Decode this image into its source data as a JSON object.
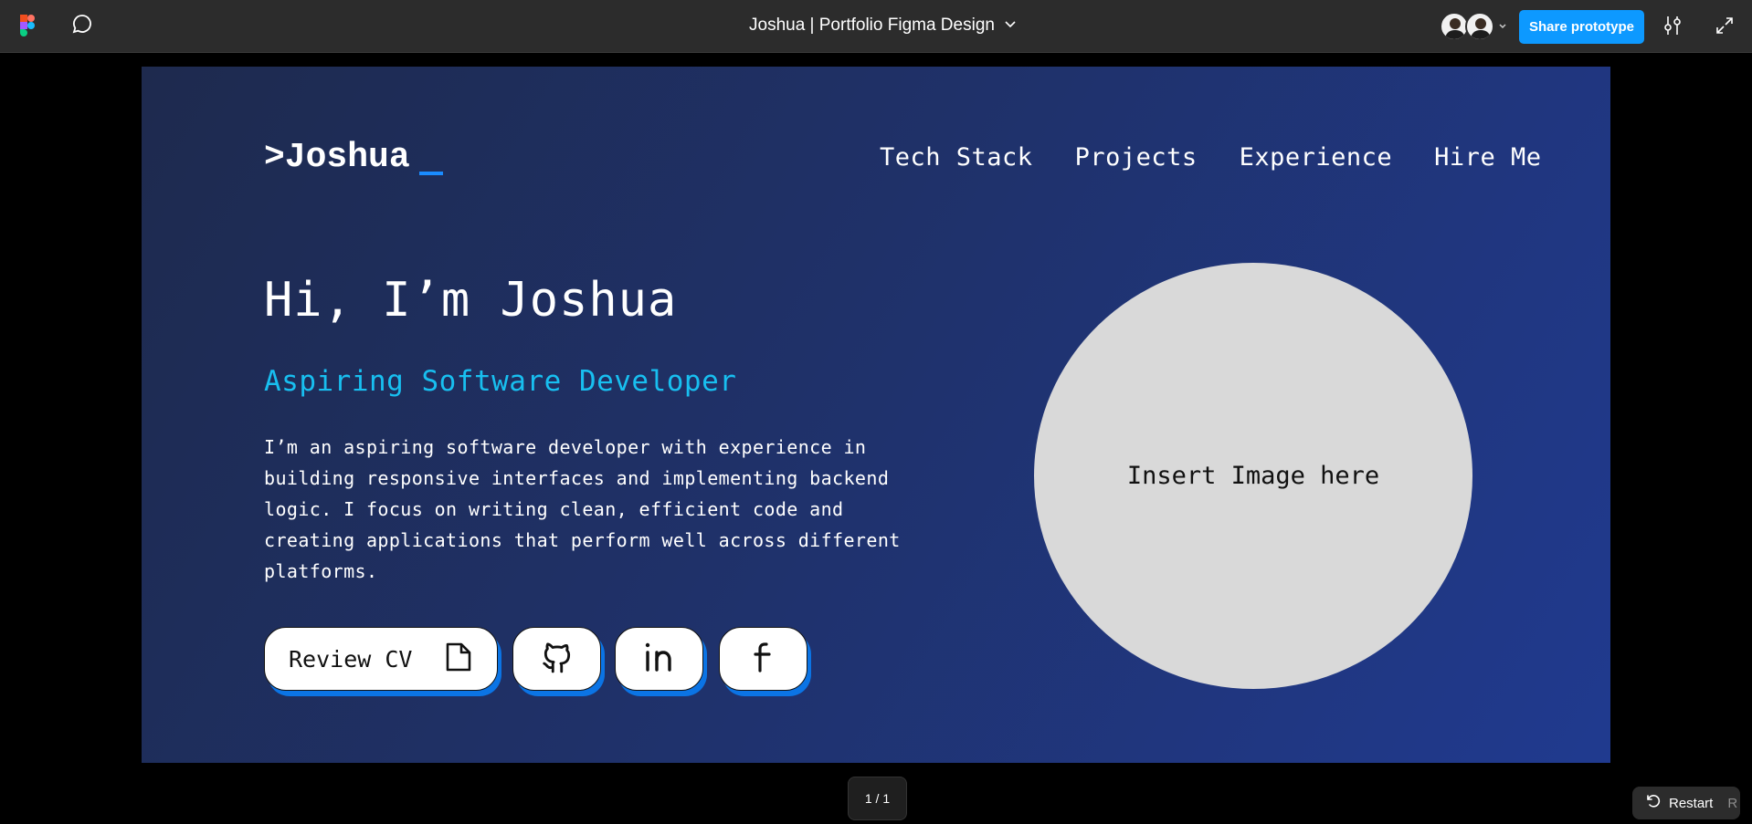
{
  "toolbar": {
    "file_title": "Joshua | Portfolio Figma Design",
    "share_label": "Share prototype"
  },
  "site": {
    "logo": ">Joshua",
    "nav": [
      "Tech Stack",
      "Projects",
      "Experience",
      "Hire Me"
    ],
    "hero_title": "Hi, I’m Joshua",
    "hero_subtitle": "Aspiring Software Developer",
    "hero_body": "I’m an aspiring software developer with experience in building responsive interfaces and implementing backend logic. I focus on writing clean, efficient code and creating applications that perform well across different platforms.",
    "cv_button_label": "Review CV",
    "photo_placeholder": "Insert Image here",
    "colors": {
      "accent_blue": "#1a8cff",
      "subtitle_cyan": "#18bff0",
      "button_shadow": "#0b74e5"
    }
  },
  "footer": {
    "page_counter": "1 / 1",
    "restart_label": "Restart",
    "restart_shortcut": "R"
  },
  "icons": [
    "figma-logo-icon",
    "comment-icon",
    "chevron-down-icon",
    "sliders-icon",
    "expand-icon",
    "file-icon",
    "github-icon",
    "linkedin-icon",
    "facebook-icon",
    "restart-icon"
  ]
}
